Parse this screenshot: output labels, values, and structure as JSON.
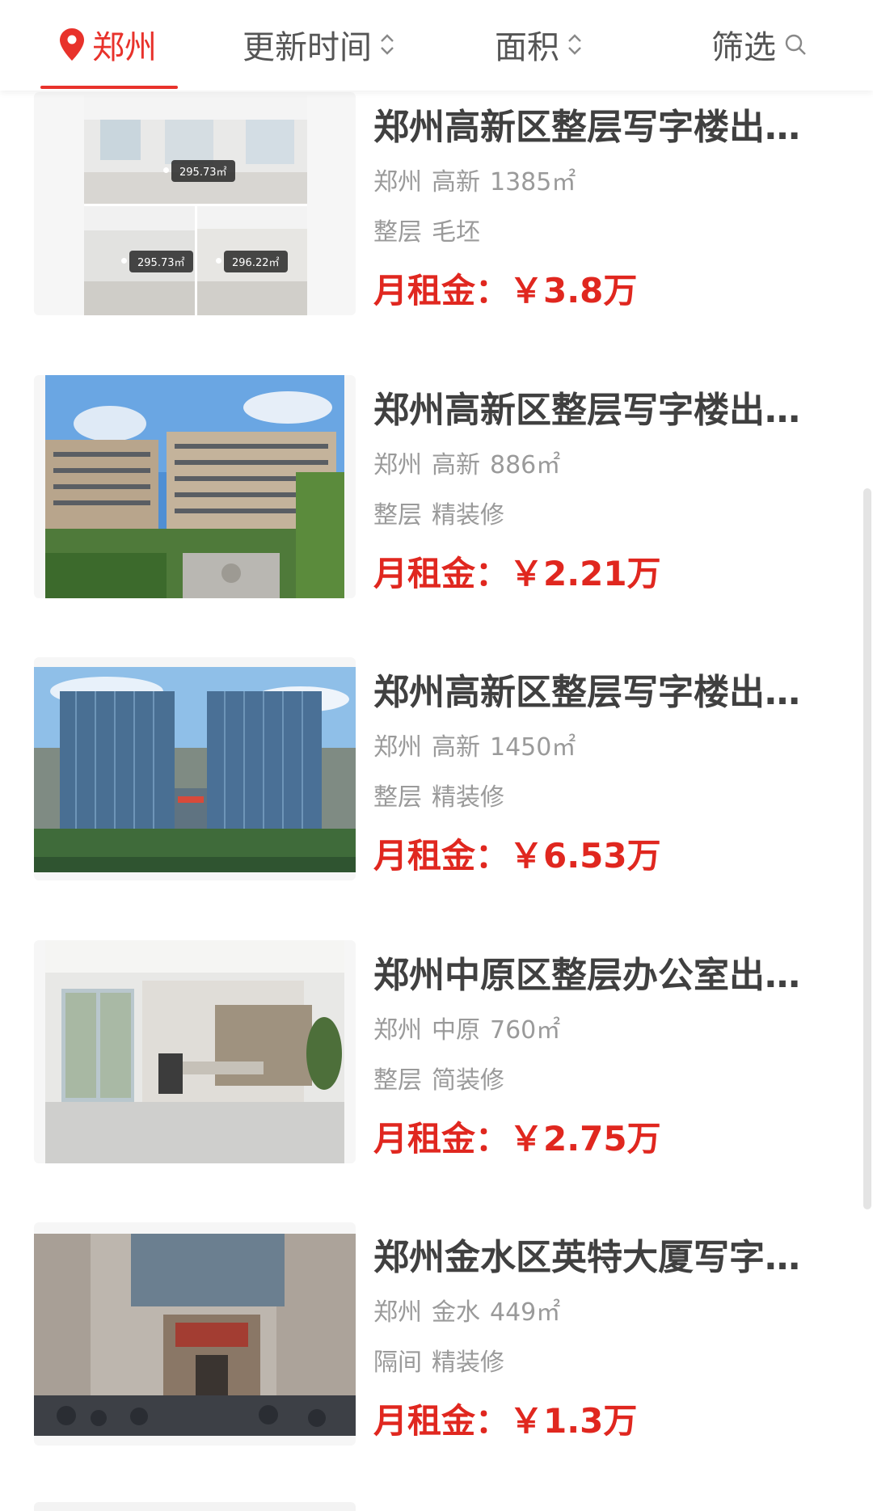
{
  "filter_bar": {
    "city": "郑州",
    "update_time": "更新时间",
    "area": "面积",
    "filter": "筛选"
  },
  "listings": [
    {
      "title": "郑州高新区整层写字楼出…",
      "city": "郑州",
      "district": "高新",
      "size": "1385㎡",
      "layout": "整层",
      "decoration": "毛坯",
      "price": "月租金：￥3.8万",
      "image_badges": [
        "295.73㎡",
        "295.73㎡",
        "296.22㎡"
      ]
    },
    {
      "title": "郑州高新区整层写字楼出…",
      "city": "郑州",
      "district": "高新",
      "size": "886㎡",
      "layout": "整层",
      "decoration": "精装修",
      "price": "月租金：￥2.21万"
    },
    {
      "title": "郑州高新区整层写字楼出…",
      "city": "郑州",
      "district": "高新",
      "size": "1450㎡",
      "layout": "整层",
      "decoration": "精装修",
      "price": "月租金：￥6.53万"
    },
    {
      "title": "郑州中原区整层办公室出…",
      "city": "郑州",
      "district": "中原",
      "size": "760㎡",
      "layout": "整层",
      "decoration": "简装修",
      "price": "月租金：￥2.75万"
    },
    {
      "title": "郑州金水区英特大厦写字…",
      "city": "郑州",
      "district": "金水",
      "size": "449㎡",
      "layout": "隔间",
      "decoration": "精装修",
      "price": "月租金：￥1.3万"
    }
  ],
  "colors": {
    "accent": "#e8322b",
    "price": "#e0271f"
  }
}
